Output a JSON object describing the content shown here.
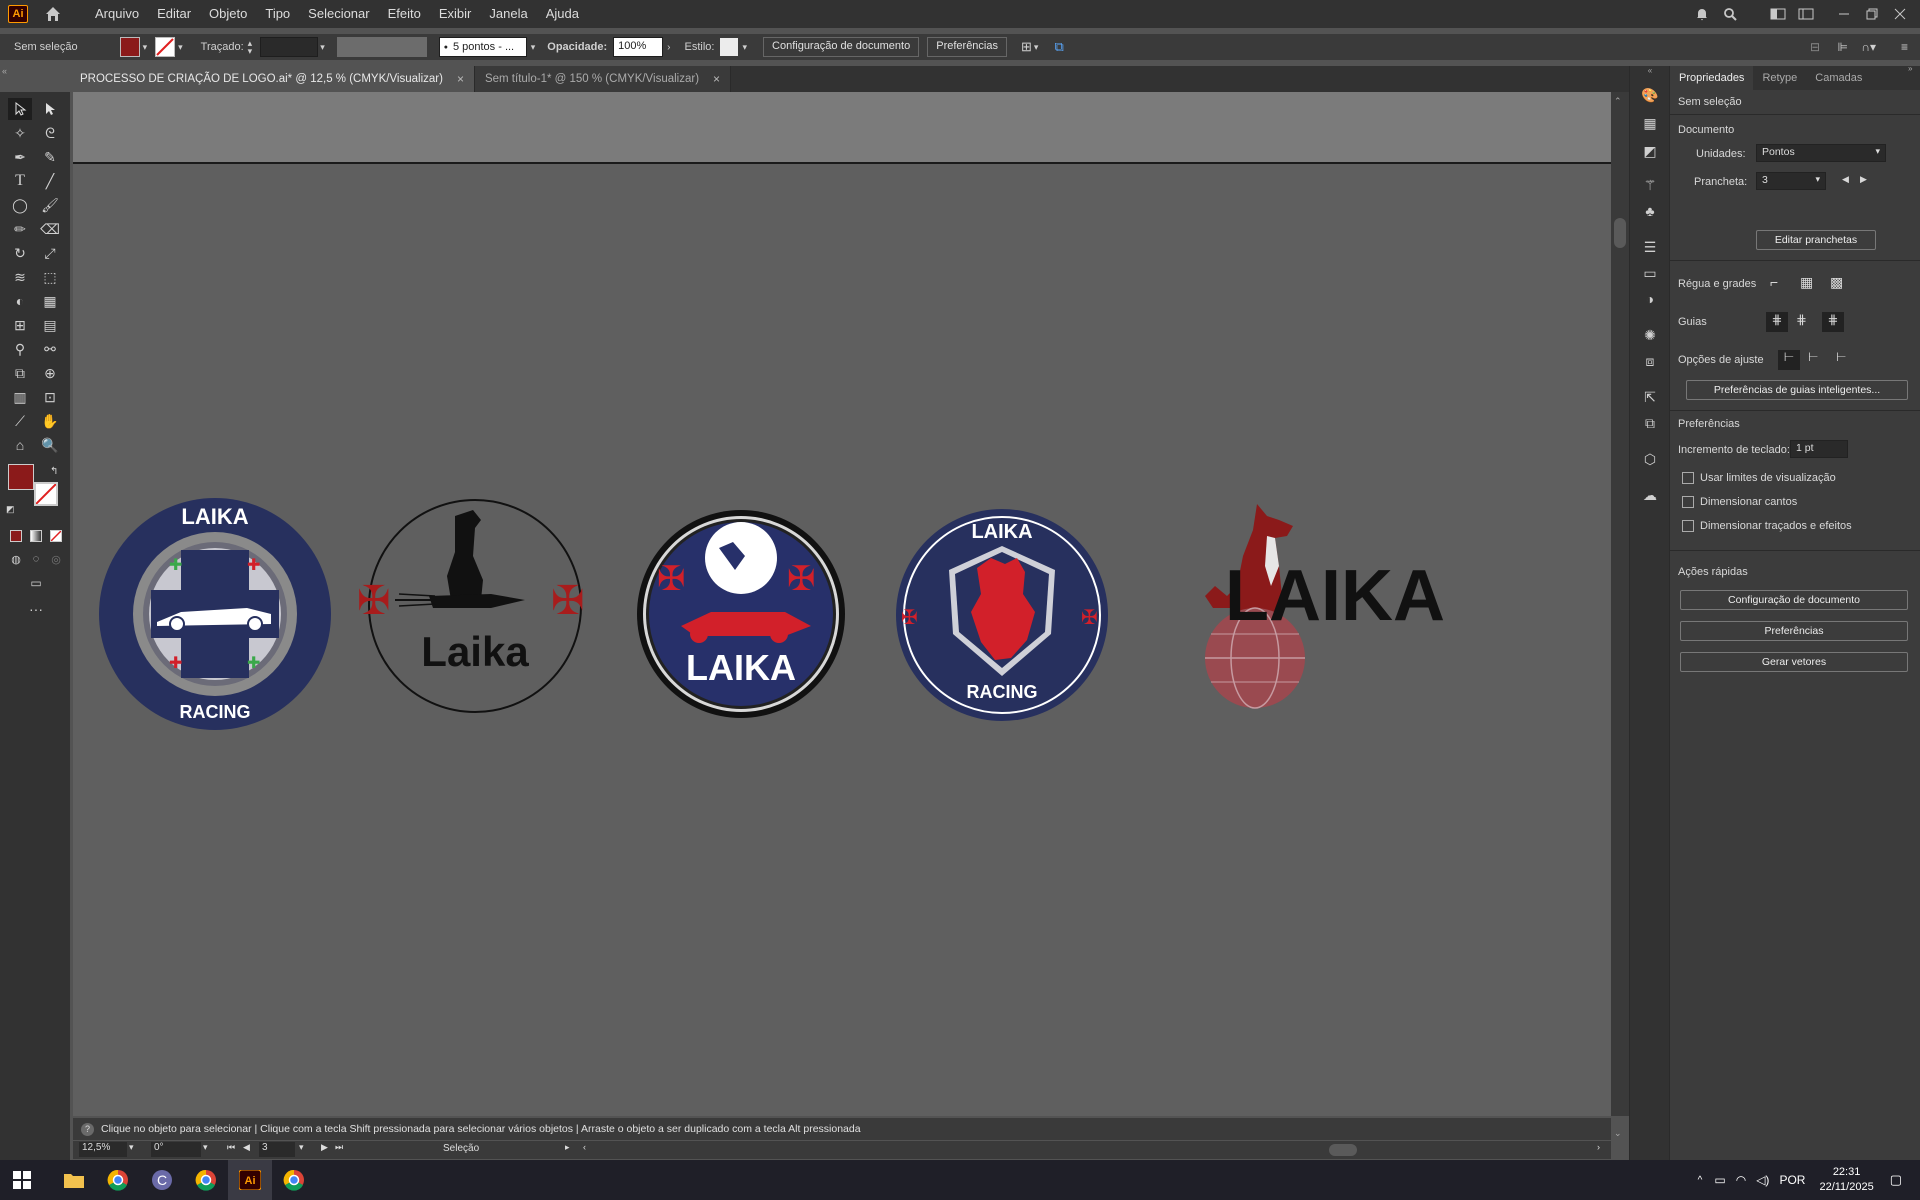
{
  "app": {
    "logo": "Ai"
  },
  "menu": [
    "Arquivo",
    "Editar",
    "Objeto",
    "Tipo",
    "Selecionar",
    "Efeito",
    "Exibir",
    "Janela",
    "Ajuda"
  ],
  "control": {
    "selection": "Sem seleção",
    "stroke_label": "Traçado:",
    "brush": "5 pontos - ...",
    "opacity_label": "Opacidade:",
    "opacity": "100%",
    "style_label": "Estilo:",
    "doc_setup": "Configuração de documento",
    "preferences": "Preferências"
  },
  "tabs": [
    {
      "label": "PROCESSO DE CRIAÇÃO DE LOGO.ai* @ 12,5 % (CMYK/Visualizar)",
      "active": true
    },
    {
      "label": "Sem título-1* @ 150 % (CMYK/Visualizar)",
      "active": false
    }
  ],
  "artwork": {
    "logo1": {
      "top": "LAIKA",
      "bottom": "RACING"
    },
    "logo2": {
      "text": "Laika"
    },
    "logo3": {
      "text": "LAIKA"
    },
    "logo4": {
      "top": "LAIKA",
      "bottom": "RACING"
    },
    "logo5": {
      "text": "LAIKA"
    }
  },
  "colors": {
    "brand_red": "#8b1a1a",
    "navy": "#27305e",
    "bright_red": "#d2202a",
    "green": "#3aa84a"
  },
  "hint": {
    "text": "Clique no objeto para selecionar  |  Clique com a tecla Shift pressionada para selecionar vários objetos  |  Arraste o objeto a ser duplicado com a tecla Alt pressionada"
  },
  "status": {
    "zoom": "12,5%",
    "rotation": "0°",
    "artboard": "3",
    "tool": "Seleção"
  },
  "panel": {
    "tabs": [
      "Propriedades",
      "Retype",
      "Camadas"
    ],
    "selection": "Sem seleção",
    "document": "Documento",
    "units_label": "Unidades:",
    "units": "Pontos",
    "artboard_label": "Prancheta:",
    "artboard": "3",
    "edit_artboards": "Editar pranchetas",
    "rulers": "Régua e grades",
    "guides": "Guias",
    "snap": "Opções de ajuste",
    "smart_guides": "Preferências de guias inteligentes...",
    "prefs_title": "Preferências",
    "keyboard_inc_label": "Incremento de teclado:",
    "keyboard_inc": "1 pt",
    "chk1": "Usar limites de visualização",
    "chk2": "Dimensionar cantos",
    "chk3": "Dimensionar traçados e efeitos",
    "quick_actions": "Ações rápidas",
    "qa1": "Configuração de documento",
    "qa2": "Preferências",
    "qa3": "Gerar vetores"
  },
  "taskbar": {
    "lang": "POR",
    "time": "22:31",
    "date": "22/11/2025"
  }
}
